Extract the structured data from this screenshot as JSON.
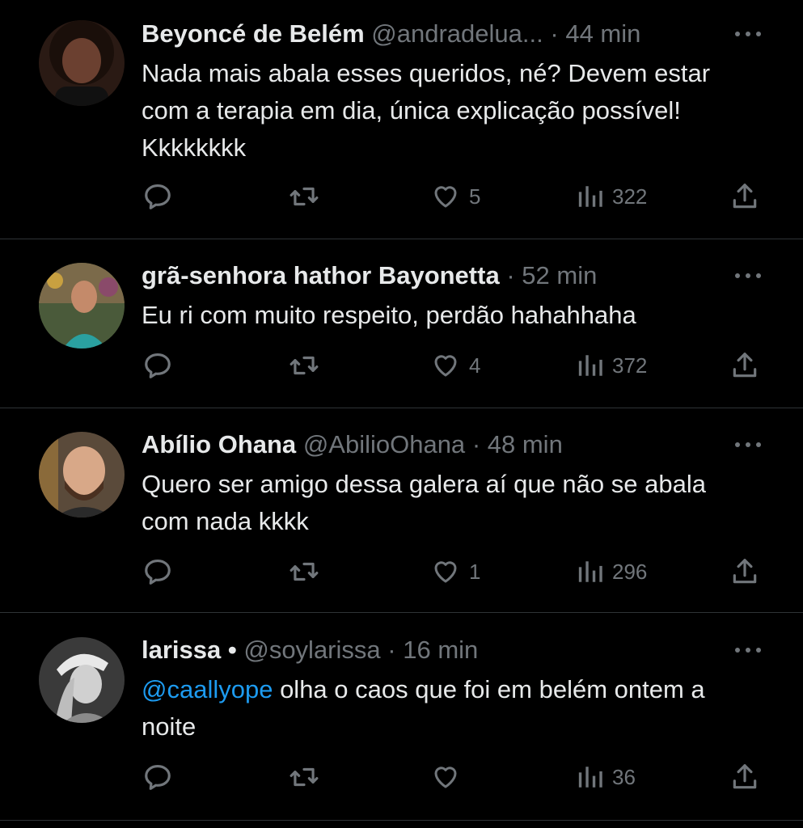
{
  "tweets": [
    {
      "name": "Beyoncé de Belém",
      "handle": "@andradelua...",
      "dot": "·",
      "time": "44 min",
      "text": "Nada mais abala esses queridos, né? Devem estar com a terapia em dia, única explicação possível! Kkkkkkkk",
      "likes": "5",
      "views": "322"
    },
    {
      "name": "grã-senhora hathor Bayonetta",
      "handle": "",
      "dot": "·",
      "time": "52 min",
      "text": "Eu ri com muito respeito, perdão hahahhaha",
      "likes": "4",
      "views": "372"
    },
    {
      "name": "Abílio Ohana",
      "handle": "@AbilioOhana",
      "dot": "·",
      "time": "48 min",
      "text": "Quero ser amigo dessa galera aí que não se abala com nada kkkk",
      "likes": "1",
      "views": "296"
    },
    {
      "name": "larissa •",
      "handle": "@soylarissa",
      "dot": "·",
      "time": "16 min",
      "mention": "@caallyope",
      "text": " olha o caos que foi em belém ontem a noite",
      "likes": "",
      "views": "36"
    }
  ],
  "icons": {
    "reply": "reply-icon",
    "retweet": "retweet-icon",
    "like": "heart-icon",
    "views": "views-icon",
    "share": "share-icon",
    "more": "more-icon"
  },
  "colors": {
    "background": "#000000",
    "text": "#e7e9ea",
    "muted": "#71767b",
    "link": "#1d9bf0",
    "divider": "#2f3336"
  }
}
